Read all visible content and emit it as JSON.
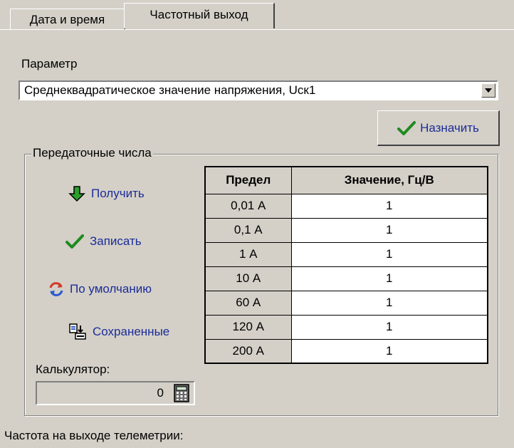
{
  "tabs": [
    {
      "label": "Дата и время",
      "active": false
    },
    {
      "label": "Частотный выход",
      "active": true
    }
  ],
  "parameter": {
    "label": "Параметр",
    "selected": "Среднеквадратическое значение напряжения, Uск1"
  },
  "assign_button": "Назначить",
  "ratios": {
    "legend": "Передаточные числа",
    "actions": {
      "get": "Получить",
      "write": "Записать",
      "default": "По умолчанию",
      "saved": "Сохраненные"
    },
    "calculator_label": "Калькулятор:",
    "calculator_value": "0",
    "table": {
      "headers": [
        "Предел",
        "Значение, Гц/В"
      ],
      "rows": [
        [
          "0,01 А",
          "1"
        ],
        [
          "0,1 А",
          "1"
        ],
        [
          "1 А",
          "1"
        ],
        [
          "10 А",
          "1"
        ],
        [
          "60 А",
          "1"
        ],
        [
          "120 А",
          "1"
        ],
        [
          "200 А",
          "1"
        ]
      ]
    }
  },
  "bottom_label": "Частота на выходе телеметрии:",
  "colors": {
    "window": "#d4d0c8",
    "link": "#1b2c98",
    "check": "#1f8a1f"
  }
}
